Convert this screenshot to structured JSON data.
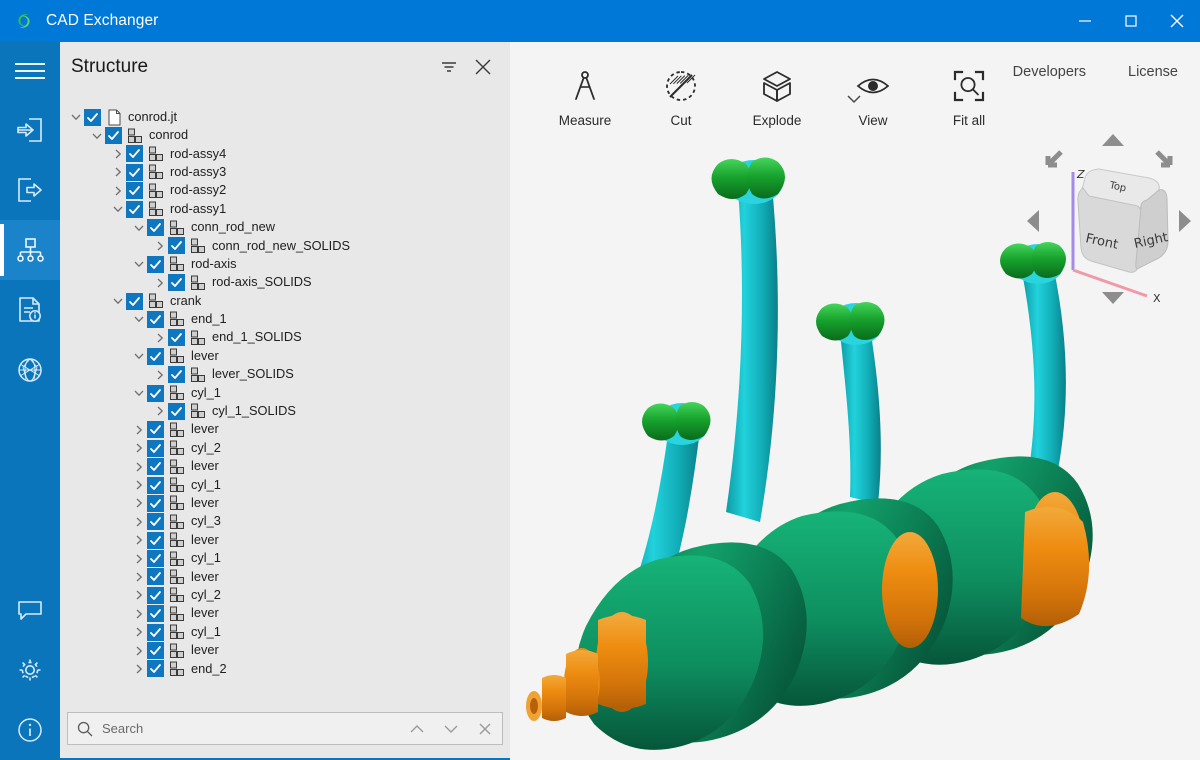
{
  "window": {
    "title": "CAD Exchanger",
    "logo_icon": "cad-exchanger-logo",
    "minimize_icon": "minimize-icon",
    "maximize_icon": "maximize-icon",
    "close_icon": "close-icon",
    "accent_color": "#0078D7"
  },
  "rail": {
    "background_color": "#0B75BC",
    "active_color": "#1A83C9",
    "items": [
      {
        "name": "menu-hamburger",
        "icon": "hamburger-icon",
        "active": false
      },
      {
        "name": "import",
        "icon": "import-arrow-into-page-icon",
        "active": false
      },
      {
        "name": "export",
        "icon": "export-arrow-out-of-page-icon",
        "active": false
      },
      {
        "name": "structure",
        "icon": "structure-tree-icon",
        "active": true
      },
      {
        "name": "properties",
        "icon": "document-info-icon",
        "active": false
      },
      {
        "name": "mesh",
        "icon": "mesh-globe-icon",
        "active": false
      }
    ],
    "bottom_items": [
      {
        "name": "feedback",
        "icon": "chat-bubble-icon"
      },
      {
        "name": "settings",
        "icon": "gear-icon"
      },
      {
        "name": "about",
        "icon": "info-circle-icon"
      }
    ]
  },
  "panel": {
    "title": "Structure",
    "background_color": "#E8E8E8",
    "filter_icon": "filter-funnel-icon",
    "close_icon": "close-icon",
    "checkbox_color": "#0F77C0"
  },
  "search": {
    "placeholder": "Search",
    "value": "",
    "search_icon": "search-icon",
    "prev_icon": "chevron-up-icon",
    "next_icon": "chevron-down-icon",
    "clear_icon": "close-icon"
  },
  "tree": {
    "rows": [
      {
        "depth": 0,
        "label": "conrod.jt",
        "icon": "file-icon",
        "expander": "expanded",
        "checked": true
      },
      {
        "depth": 1,
        "label": "conrod",
        "icon": "assembly-icon",
        "expander": "expanded",
        "checked": true
      },
      {
        "depth": 2,
        "label": "rod-assy4",
        "icon": "assembly-icon",
        "expander": "collapsed",
        "checked": true
      },
      {
        "depth": 2,
        "label": "rod-assy3",
        "icon": "assembly-icon",
        "expander": "collapsed",
        "checked": true
      },
      {
        "depth": 2,
        "label": "rod-assy2",
        "icon": "assembly-icon",
        "expander": "collapsed",
        "checked": true
      },
      {
        "depth": 2,
        "label": "rod-assy1",
        "icon": "assembly-icon",
        "expander": "expanded",
        "checked": true
      },
      {
        "depth": 3,
        "label": "conn_rod_new",
        "icon": "assembly-icon",
        "expander": "expanded",
        "checked": true
      },
      {
        "depth": 4,
        "label": "conn_rod_new_SOLIDS",
        "icon": "assembly-icon",
        "expander": "collapsed",
        "checked": true
      },
      {
        "depth": 3,
        "label": "rod-axis",
        "icon": "assembly-icon",
        "expander": "expanded",
        "checked": true
      },
      {
        "depth": 4,
        "label": "rod-axis_SOLIDS",
        "icon": "assembly-icon",
        "expander": "collapsed",
        "checked": true
      },
      {
        "depth": 2,
        "label": "crank",
        "icon": "assembly-icon",
        "expander": "expanded",
        "checked": true
      },
      {
        "depth": 3,
        "label": "end_1",
        "icon": "assembly-icon",
        "expander": "expanded",
        "checked": true
      },
      {
        "depth": 4,
        "label": "end_1_SOLIDS",
        "icon": "assembly-icon",
        "expander": "collapsed",
        "checked": true
      },
      {
        "depth": 3,
        "label": "lever",
        "icon": "assembly-icon",
        "expander": "expanded",
        "checked": true
      },
      {
        "depth": 4,
        "label": "lever_SOLIDS",
        "icon": "assembly-icon",
        "expander": "collapsed",
        "checked": true
      },
      {
        "depth": 3,
        "label": "cyl_1",
        "icon": "assembly-icon",
        "expander": "expanded",
        "checked": true
      },
      {
        "depth": 4,
        "label": "cyl_1_SOLIDS",
        "icon": "assembly-icon",
        "expander": "collapsed",
        "checked": true
      },
      {
        "depth": 3,
        "label": "lever",
        "icon": "assembly-icon",
        "expander": "collapsed",
        "checked": true
      },
      {
        "depth": 3,
        "label": "cyl_2",
        "icon": "assembly-icon",
        "expander": "collapsed",
        "checked": true
      },
      {
        "depth": 3,
        "label": "lever",
        "icon": "assembly-icon",
        "expander": "collapsed",
        "checked": true
      },
      {
        "depth": 3,
        "label": "cyl_1",
        "icon": "assembly-icon",
        "expander": "collapsed",
        "checked": true
      },
      {
        "depth": 3,
        "label": "lever",
        "icon": "assembly-icon",
        "expander": "collapsed",
        "checked": true
      },
      {
        "depth": 3,
        "label": "cyl_3",
        "icon": "assembly-icon",
        "expander": "collapsed",
        "checked": true
      },
      {
        "depth": 3,
        "label": "lever",
        "icon": "assembly-icon",
        "expander": "collapsed",
        "checked": true
      },
      {
        "depth": 3,
        "label": "cyl_1",
        "icon": "assembly-icon",
        "expander": "collapsed",
        "checked": true
      },
      {
        "depth": 3,
        "label": "lever",
        "icon": "assembly-icon",
        "expander": "collapsed",
        "checked": true
      },
      {
        "depth": 3,
        "label": "cyl_2",
        "icon": "assembly-icon",
        "expander": "collapsed",
        "checked": true
      },
      {
        "depth": 3,
        "label": "lever",
        "icon": "assembly-icon",
        "expander": "collapsed",
        "checked": true
      },
      {
        "depth": 3,
        "label": "cyl_1",
        "icon": "assembly-icon",
        "expander": "collapsed",
        "checked": true
      },
      {
        "depth": 3,
        "label": "lever",
        "icon": "assembly-icon",
        "expander": "collapsed",
        "checked": true
      },
      {
        "depth": 3,
        "label": "end_2",
        "icon": "assembly-icon",
        "expander": "collapsed",
        "checked": true
      }
    ]
  },
  "viewport": {
    "background_color": "#F4F4F4",
    "toolbar": [
      {
        "label": "Measure",
        "icon": "compass-divider-icon"
      },
      {
        "label": "Cut",
        "icon": "clip-plane-crossed-circle-icon"
      },
      {
        "label": "Explode",
        "icon": "cube-explode-icon"
      },
      {
        "label": "View",
        "icon": "eye-icon"
      },
      {
        "label": "Fit all",
        "icon": "fit-all-magnifier-icon"
      }
    ],
    "toolbar_caret_icon": "chevron-down-icon",
    "links": [
      {
        "label": "Developers"
      },
      {
        "label": "License"
      }
    ],
    "view_cube": {
      "faces": {
        "top": "Top",
        "front": "Front",
        "right": "Right"
      },
      "axes": {
        "z": "Z",
        "x": "X"
      },
      "arrows": [
        "up-arrow",
        "down-arrow",
        "left-arrow",
        "right-arrow",
        "rotate-ccw-arrow",
        "rotate-cw-arrow"
      ]
    },
    "model": {
      "name": "crankshaft-with-connecting-rods",
      "colors": {
        "crank_body": "#0E8A5F",
        "journal": "#E8860F",
        "conrod": "#18C3C9",
        "rod_pin": "#159B2E"
      }
    }
  }
}
